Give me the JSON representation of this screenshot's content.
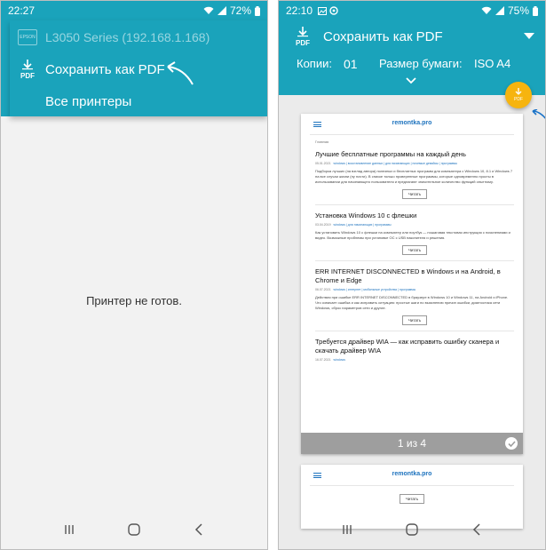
{
  "left_phone": {
    "status": {
      "time": "22:27",
      "battery": "72%"
    },
    "menu": {
      "printer_name": "L3050 Series (192.168.1.168)",
      "printer_logo": "EPSON",
      "save_pdf_label": "Сохранить как PDF",
      "pdf_icon_label": "PDF",
      "all_printers_label": "Все принтеры"
    },
    "message": "Принтер не готов."
  },
  "right_phone": {
    "status": {
      "time": "22:10",
      "battery": "75%"
    },
    "header": {
      "title": "Сохранить как PDF",
      "pdf_icon_label": "PDF",
      "copies_label": "Копии:",
      "copies_value": "01",
      "paper_size_label": "Размер бумаги:",
      "paper_size_value": "ISO A4"
    },
    "fab_label": "PDF",
    "preview": {
      "site_name": "remontka.pro",
      "breadcrumb": "Главная",
      "read_button": "Читать",
      "page_indicator": "1 из 4",
      "articles": [
        {
          "title": "Лучшие бесплатные программы на каждый день",
          "date": "05.01.2021",
          "tags": "windows | восстановление данных | для начинающих | почемые девайсы | программы",
          "body": "Подборка лучших (на взгляд автора) полезных и бесплатных программ для компьютера с Windows 10, 8.1 и Windows 7 на все случаи жизни (ну почти). В списке только проверенные программы, которые одновременно просты в использовании для начинающего пользователя и предлагают значительное количество функций опытному."
        },
        {
          "title": "Установка Windows 10 с флешки",
          "date": "03.04.2019",
          "tags": "windows | для начинающих | программы",
          "body": "Как установить Windows 10 с флешки на компьютер или ноутбук — пошаговая текстовая инструкция с пояснениями и видео. Возможные проблемы при установке ОС с USB накопителя и решения."
        },
        {
          "title": "ERR INTERNET DISCONNECTED в Windows и на Android, в Chrome и Edge",
          "date": "06.07.2021",
          "tags": "windows | интернет | мобильные устройства | программы",
          "body": "Действия при ошибке ERR INTERNET DISCONNECTED в браузере в Windows 10 и Windows 11, на Android и iPhone. Что означает ошибка и как исправить ситуацию: простые шаги по выяснению причин ошибки, диагностика сети Windows, сброс параметров сети и другие."
        },
        {
          "title": "Требуется драйвер WIA — как исправить ошибку сканера и скачать драйвер WIA",
          "date": "16.07.2021",
          "tags": "windows",
          "body": ""
        }
      ]
    }
  },
  "colors": {
    "accent": "#1aa3bb",
    "fab": "#f6b40f",
    "link": "#1e73be"
  },
  "icons": [
    "wifi-icon",
    "signal-icon",
    "battery-icon",
    "pdf-download-icon",
    "chevron-down-icon",
    "menu-icon",
    "check-icon",
    "recents-icon",
    "home-icon",
    "back-icon"
  ]
}
